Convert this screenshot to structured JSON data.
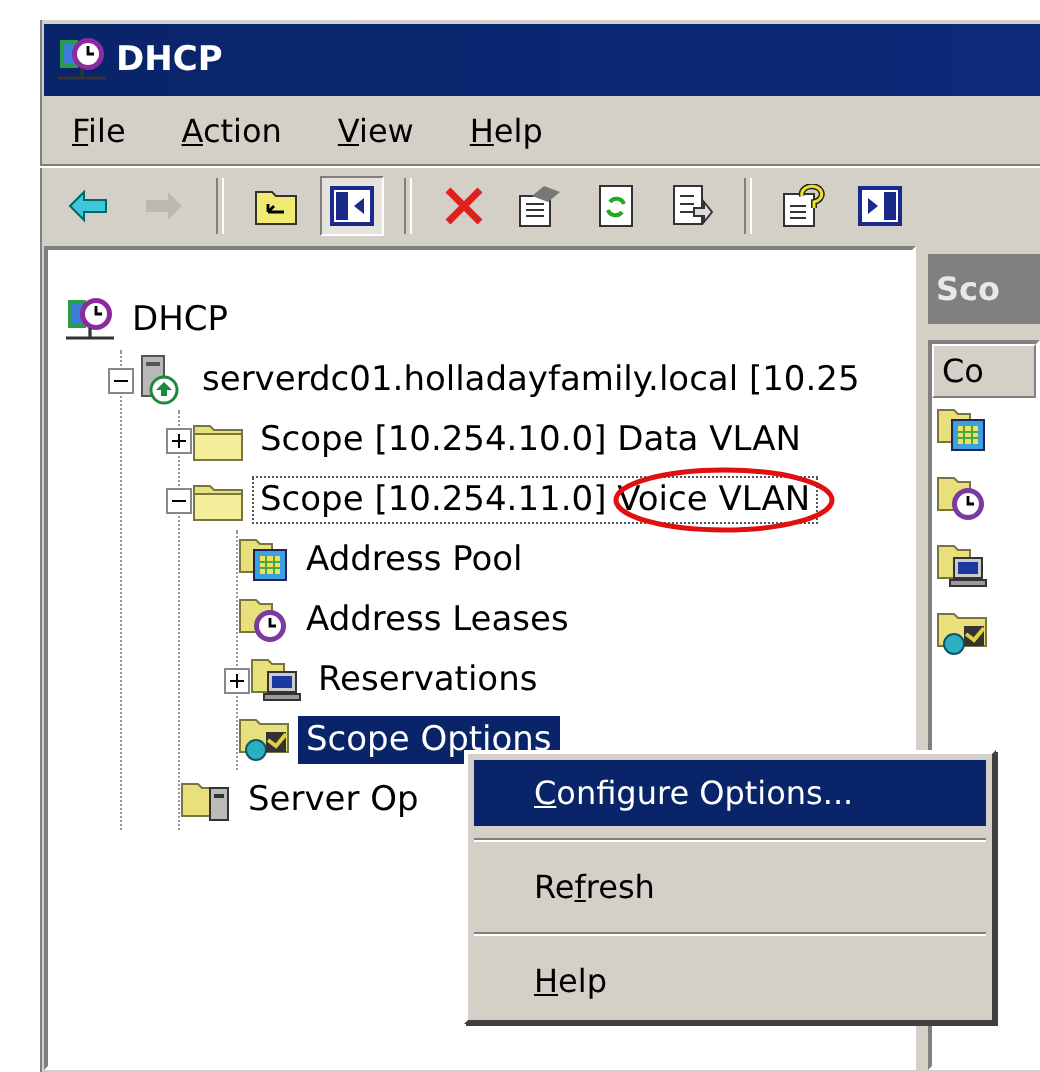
{
  "window": {
    "title": "DHCP"
  },
  "menu_bar": [
    {
      "key": "F",
      "after": "ile"
    },
    {
      "key": "A",
      "after": "ction"
    },
    {
      "key": "V",
      "after": "iew"
    },
    {
      "key": "H",
      "after": "elp"
    }
  ],
  "toolbar": [
    {
      "kind": "back",
      "disabled": false,
      "pressed": false
    },
    {
      "kind": "forward",
      "disabled": true,
      "pressed": false
    },
    {
      "kind": "sep"
    },
    {
      "kind": "up",
      "disabled": false,
      "pressed": false
    },
    {
      "kind": "tree",
      "disabled": false,
      "pressed": true
    },
    {
      "kind": "sep"
    },
    {
      "kind": "delete",
      "disabled": false,
      "pressed": false
    },
    {
      "kind": "properties",
      "disabled": false,
      "pressed": false
    },
    {
      "kind": "refresh",
      "disabled": false,
      "pressed": false
    },
    {
      "kind": "export",
      "disabled": false,
      "pressed": false
    },
    {
      "kind": "sep"
    },
    {
      "kind": "help",
      "disabled": false,
      "pressed": false
    },
    {
      "kind": "action-pane",
      "disabled": false,
      "pressed": false
    }
  ],
  "tree": [
    {
      "label": "DHCP",
      "kind": "dhcp",
      "selected": false,
      "focused": false,
      "children": [
        {
          "label": "serverdc01.holladayfamily.local [10.25",
          "kind": "server",
          "expanded": true,
          "selected": false,
          "focused": false,
          "children": [
            {
              "label": "Scope [10.254.10.0] Data VLAN",
              "kind": "folder",
              "expanded": false,
              "selected": false,
              "focused": false,
              "circled": false
            },
            {
              "label": "Scope [10.254.11.0] Voice VLAN",
              "kind": "folder",
              "expanded": true,
              "selected": false,
              "focused": true,
              "circled": true,
              "children": [
                {
                  "label": "Address Pool",
                  "kind": "pool",
                  "selected": false,
                  "focused": false
                },
                {
                  "label": "Address Leases",
                  "kind": "leases",
                  "selected": false,
                  "focused": false
                },
                {
                  "label": "Reservations",
                  "kind": "reservations",
                  "expanded": false,
                  "selected": false,
                  "focused": false
                },
                {
                  "label": "Scope Options",
                  "kind": "options",
                  "selected": true,
                  "focused": false
                }
              ]
            },
            {
              "label": "Server Op",
              "kind": "server-options",
              "selected": false,
              "focused": false,
              "circled": false
            }
          ]
        }
      ]
    }
  ],
  "right_pane": {
    "title": "Sco",
    "column": "Co",
    "rows": [
      {
        "kind": "pool"
      },
      {
        "kind": "leases"
      },
      {
        "kind": "reservations"
      },
      {
        "kind": "options"
      }
    ]
  },
  "context_menu": [
    {
      "kind": "item",
      "key": "C",
      "after": "onfigure Options...",
      "selected": true
    },
    {
      "kind": "separator"
    },
    {
      "kind": "item",
      "before": "Re",
      "key": "f",
      "after": "resh",
      "selected": false
    },
    {
      "kind": "separator"
    },
    {
      "kind": "item",
      "key": "H",
      "after": "elp",
      "selected": false
    }
  ]
}
